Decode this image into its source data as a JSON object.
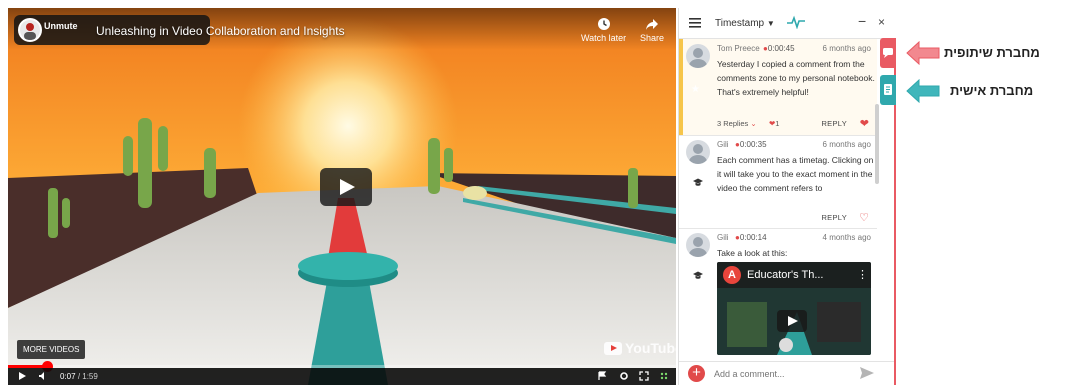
{
  "video": {
    "unmute_label": "Unmute",
    "title": "Unleashing in Video Collaboration and Insights",
    "watch_later_label": "Watch later",
    "share_label": "Share",
    "more_videos_label": "MORE VIDEOS",
    "youtube_label": "YouTube",
    "current_time": "0:07",
    "duration": "/ 1:59",
    "progress_fraction": 0.059
  },
  "panel": {
    "sort_label": "Timestamp",
    "minimize_label": "−",
    "close_label": "×",
    "comments": [
      {
        "author": "Tom Preece",
        "timestamp": "0:00:45",
        "ago": "6 months ago",
        "text": "Yesterday I copied a comment from the comments zone to my personal notebook. That's extremely helpful!",
        "replies": "3 Replies",
        "likes": "1",
        "reply_label": "REPLY"
      },
      {
        "author": "Gili",
        "timestamp": "0:00:35",
        "ago": "6 months ago",
        "text": "Each comment has a timetag. Clicking on it will take you to the exact moment in the video the comment refers to",
        "reply_label": "REPLY"
      },
      {
        "author": "Gili",
        "timestamp": "0:00:14",
        "ago": "4 months ago",
        "text": "Take a look at this:",
        "embed_title": "Educator's Th..."
      }
    ],
    "composer_placeholder": "Add a comment..."
  },
  "labels": {
    "collaborative": "מחברת שיתופית",
    "personal": "מחברת אישית"
  },
  "colors": {
    "accent_red": "#e95a63",
    "accent_teal": "#2fa8ad",
    "highlight_yellow": "#f6c54a",
    "progress_red": "#ff0000"
  }
}
